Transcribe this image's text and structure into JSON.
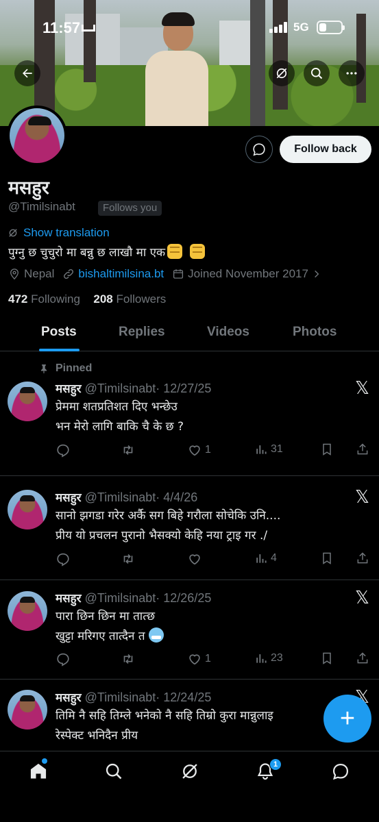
{
  "status_bar": {
    "time": "11:57",
    "network": "5G"
  },
  "profile": {
    "name": "मसहुर",
    "handle": "@Timilsinabt",
    "follows_you": "Follows you",
    "show_translation": "Show translation",
    "bio": "पुग्नु छ चुचुरो मा बन्नु छ लाखौ मा एक",
    "location": "Nepal",
    "website": "bishaltimilsina.bt",
    "joined": "Joined November 2017",
    "following_count": "472",
    "following_label": "Following",
    "followers_count": "208",
    "followers_label": "Followers",
    "follow_back_label": "Follow back"
  },
  "tabs": [
    "Posts",
    "Replies",
    "Videos",
    "Photos"
  ],
  "pinned_label": "Pinned",
  "posts": [
    {
      "name": "मसहुर",
      "handle": "@Timilsinabt",
      "date": "· 12/27/25",
      "line1": "प्रेममा शतप्रतिशत दिए भन्छेउ",
      "line2": "भन मेरो लागि बाकि चै के छ ?",
      "likes": "1",
      "views": "31"
    },
    {
      "name": "मसहुर",
      "handle": "@Timilsinabt",
      "date": "· 4/4/26",
      "line1": "सानो झगडा गरेर अर्कै सग बिहे गरौला सोचेकि उनि....",
      "line2": " प्रीय यो प्रचलन पुरानो भैसक्यो केहि नया ट्राइ गर ./",
      "likes": "",
      "views": "4"
    },
    {
      "name": "मसहुर",
      "handle": "@Timilsinabt",
      "date": "· 12/26/25",
      "line1": "पारा छिन छिन मा तात्छ",
      "line2": "खुट्टा मरिगए तात्दैन त",
      "likes": "1",
      "views": "23"
    },
    {
      "name": "मसहुर",
      "handle": "@Timilsinabt",
      "date": "· 12/24/25",
      "line1": "तिमि नै सहि तिम्ले भनेको नै सहि तिम्रो कुरा मान्नुलाइ",
      "line2": "रेस्पेक्ट भनिदैन प्रीय"
    }
  ],
  "fab_label": "+",
  "notifications_badge": "1",
  "colors": {
    "accent": "#1d9bf0",
    "background": "#000000",
    "muted": "#71767b"
  }
}
